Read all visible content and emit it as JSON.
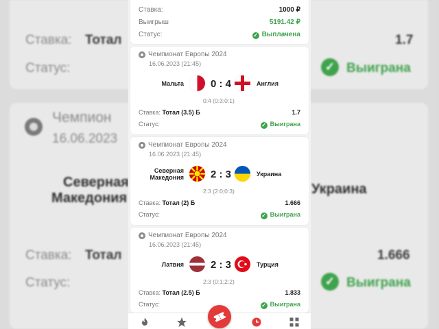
{
  "top_card": {
    "stake_label": "Ставка:",
    "stake_value": "1000 ₽",
    "winnings_label": "Выигрыш",
    "winnings_value": "5191.42 ₽",
    "status_label": "Статус:",
    "status_value": "Выплачена"
  },
  "matches": [
    {
      "league": "Чемпионат Европы 2024",
      "date": "16.06.2023 (21:45)",
      "home": "Мальта",
      "away": "Англия",
      "score": "0 : 4",
      "sub_score": "0:4 (0:3;0:1)",
      "bet_label": "Ставка:",
      "bet_type": "Тотал (3.5) Б",
      "odds": "1.7",
      "status_label": "Статус:",
      "status": "Выиграна"
    },
    {
      "league": "Чемпионат Европы 2024",
      "date": "16.06.2023 (21:45)",
      "home_line1": "Северная",
      "home_line2": "Македония",
      "away": "Украина",
      "score": "2 : 3",
      "sub_score": "2:3 (2:0;0:3)",
      "bet_label": "Ставка:",
      "bet_type": "Тотал (2) Б",
      "odds": "1.666",
      "status_label": "Статус:",
      "status": "Выиграна"
    },
    {
      "league": "Чемпионат Европы 2024",
      "date": "16.06.2023 (21:45)",
      "home": "Латвия",
      "away": "Турция",
      "score": "2 : 3",
      "sub_score": "2:3 (0:1;2:2)",
      "bet_label": "Ставка:",
      "bet_type": "Тотал (2.5) Б",
      "odds": "1.833",
      "status_label": "Статус:",
      "status": "Выиграна"
    }
  ],
  "background": {
    "row1_label": "Ставка:",
    "row1_bet": "Тотал",
    "row1_odds": "1.7",
    "row2_label": "Статус:",
    "row2_status": "Выиграна",
    "league": "Чемпион",
    "date": "16.06.2023",
    "home_line1": "Северная",
    "home_line2": "Македония",
    "away": "Украина",
    "row3_label": "Ставка:",
    "row3_bet": "Тотал",
    "row3_odds": "1.666",
    "row4_label": "Статус:",
    "row4_status": "Выиграна"
  },
  "nav": {
    "items": [
      "fire-icon",
      "star-icon",
      "ticket-icon",
      "clock-icon",
      "grid-icon"
    ]
  },
  "colors": {
    "accent": "#e33a3a",
    "success": "#3fa34d"
  }
}
